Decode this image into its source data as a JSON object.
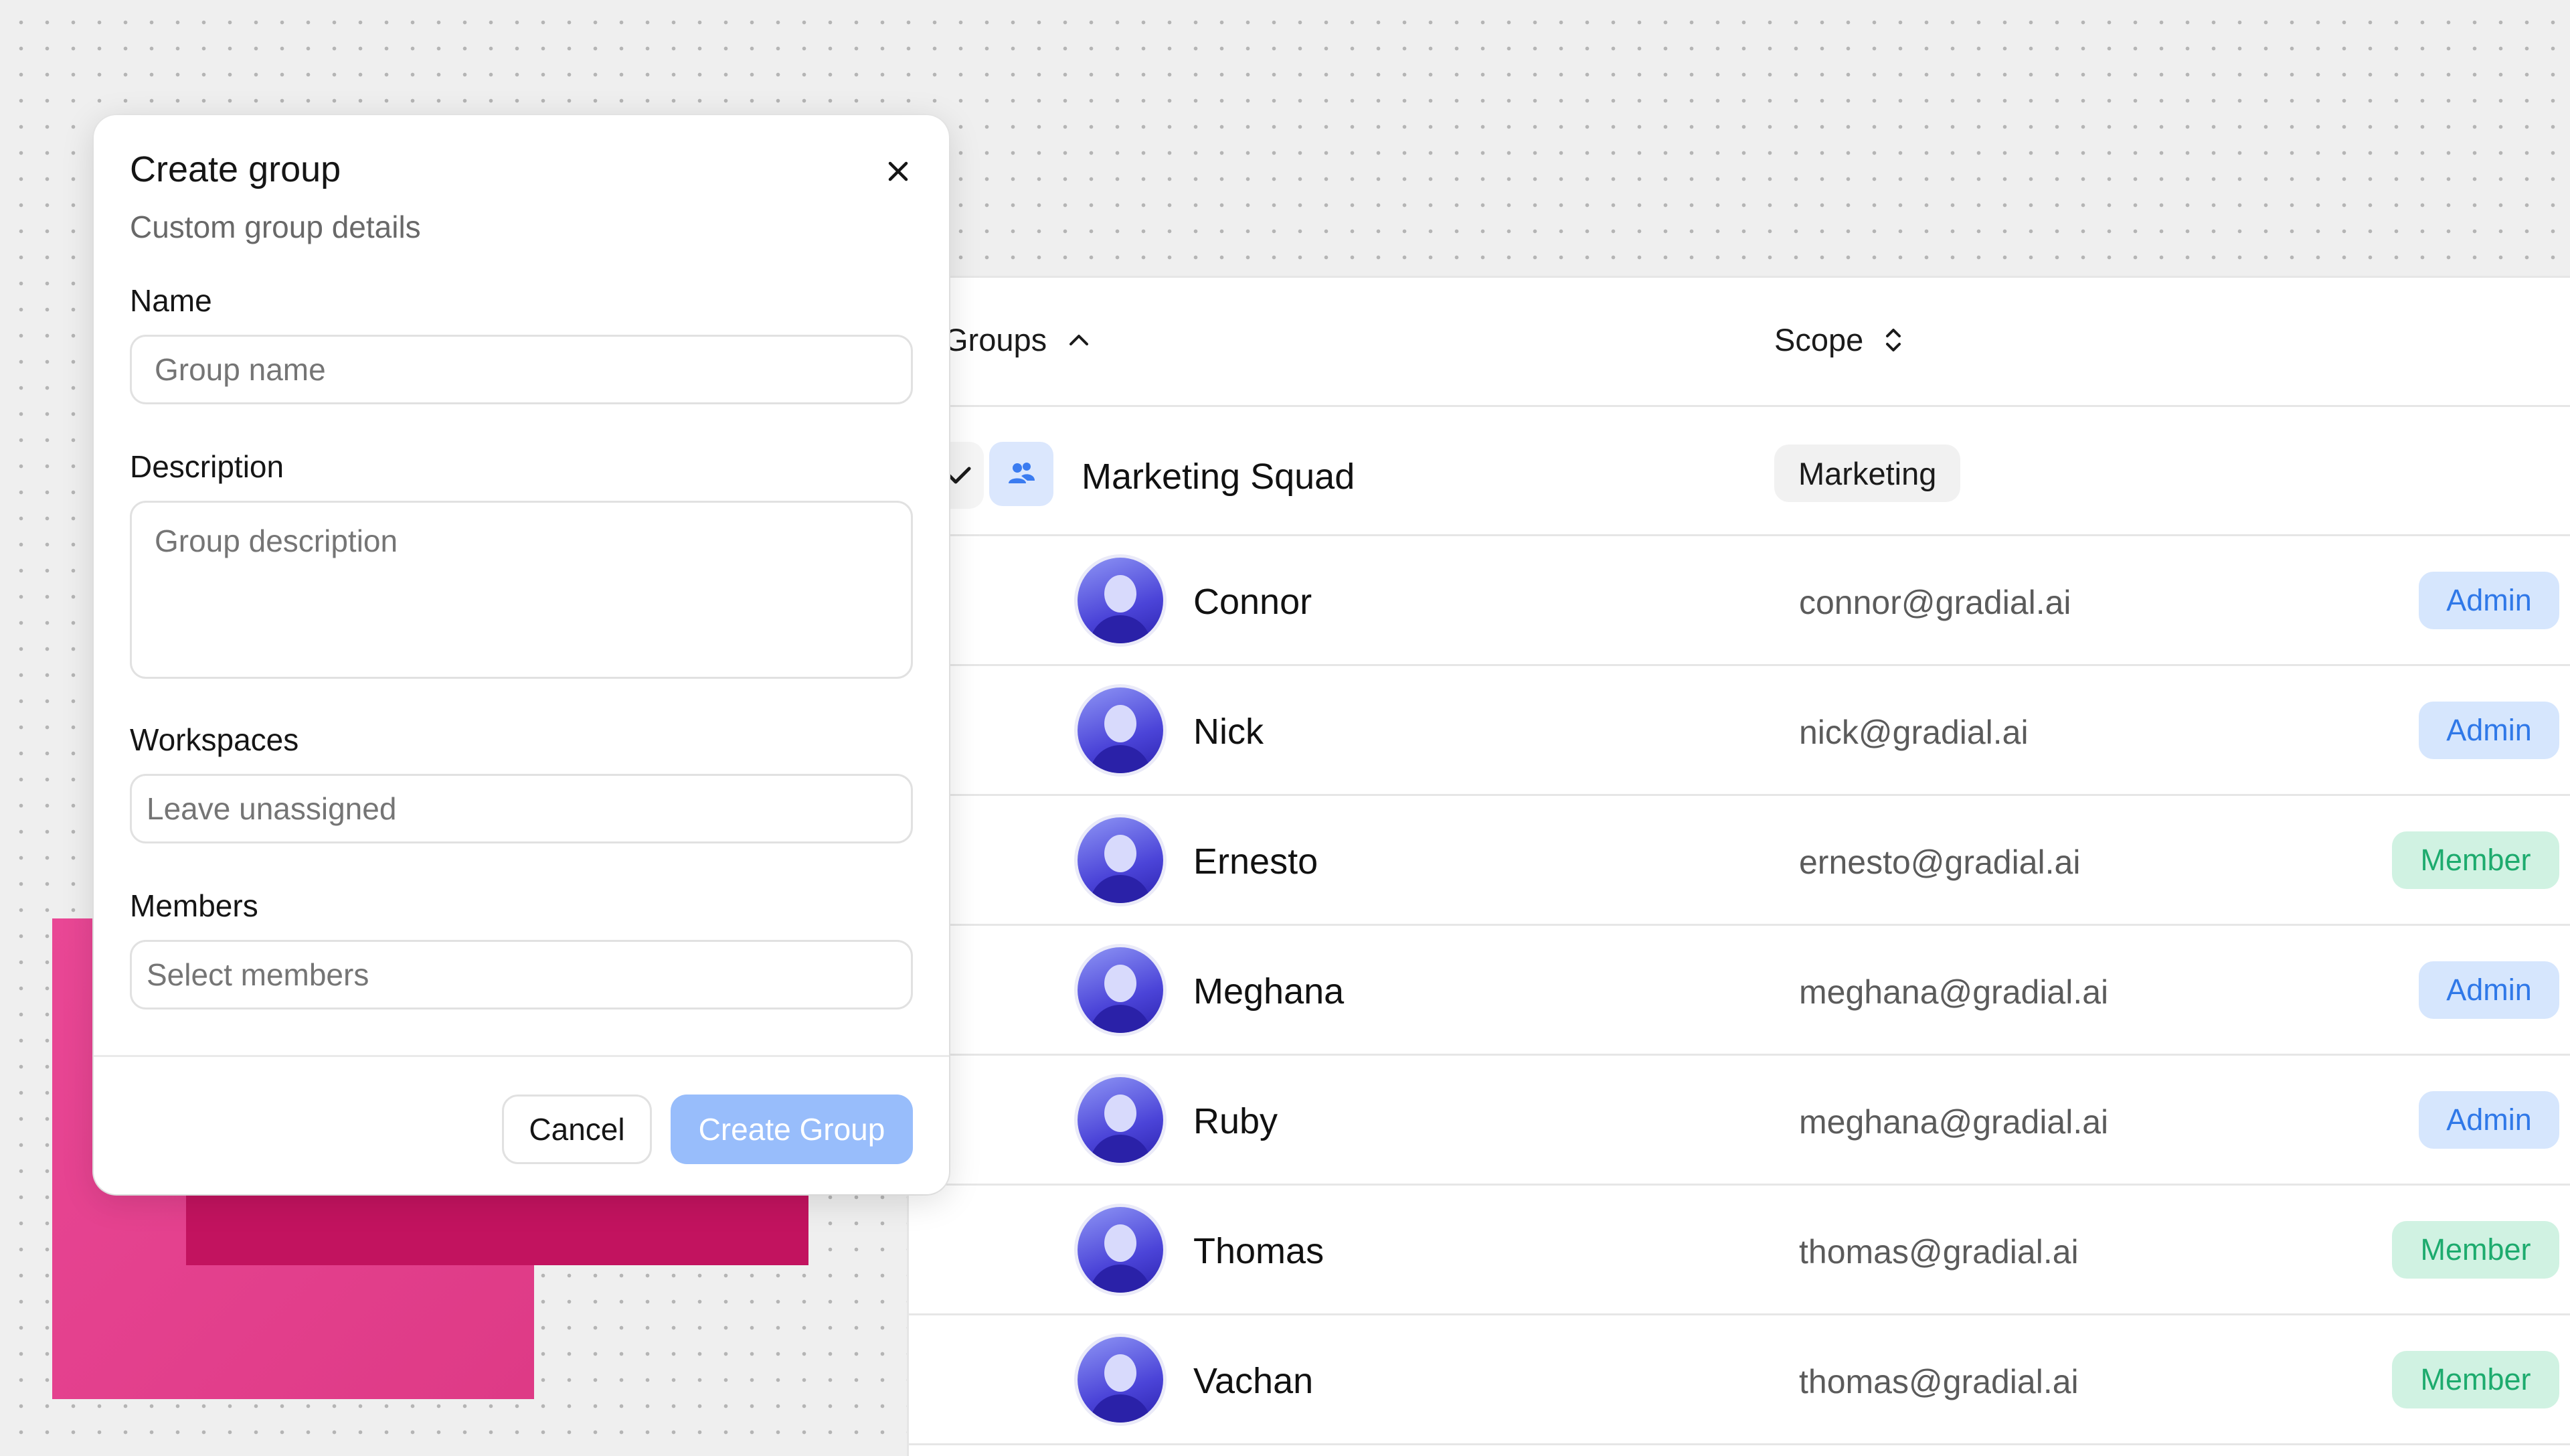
{
  "modal": {
    "title": "Create group",
    "subtitle": "Custom group details",
    "name_label": "Name",
    "name_placeholder": "Group name",
    "description_label": "Description",
    "description_placeholder": "Group description",
    "workspaces_label": "Workspaces",
    "workspaces_placeholder": "Leave unassigned",
    "members_label": "Members",
    "members_placeholder": "Select members",
    "cancel_label": "Cancel",
    "create_label": "Create Group",
    "close_icon": "close-icon"
  },
  "table": {
    "groups_header": "Groups",
    "scope_header": "Scope",
    "group": {
      "name": "Marketing Squad",
      "scope": "Marketing",
      "icon": "users-icon"
    },
    "users": [
      {
        "name": "Connor",
        "email": "connor@gradial.ai",
        "role": "Admin"
      },
      {
        "name": "Nick",
        "email": "nick@gradial.ai",
        "role": "Admin"
      },
      {
        "name": "Ernesto",
        "email": "ernesto@gradial.ai",
        "role": "Member"
      },
      {
        "name": "Meghana",
        "email": "meghana@gradial.ai",
        "role": "Admin"
      },
      {
        "name": "Ruby",
        "email": "meghana@gradial.ai",
        "role": "Admin"
      },
      {
        "name": "Thomas",
        "email": "thomas@gradial.ai",
        "role": "Member"
      },
      {
        "name": "Vachan",
        "email": "thomas@gradial.ai",
        "role": "Member"
      }
    ]
  },
  "colors": {
    "accent": "#98bdfb",
    "admin": "#2f78e8",
    "member": "#1dab6e",
    "brand_pink": "#e94795",
    "brand_pink_dark": "#c2135f"
  }
}
